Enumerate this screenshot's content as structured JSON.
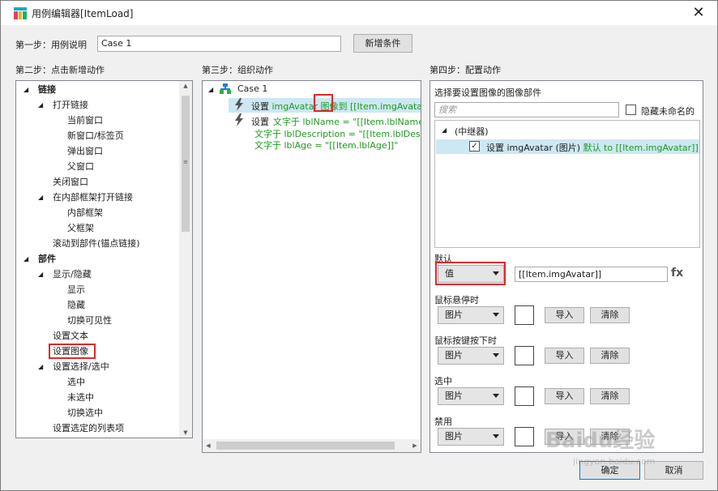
{
  "window": {
    "title": "用例编辑器[ItemLoad]",
    "close": "✕"
  },
  "step1": {
    "label": "第一步：用例说明",
    "case_value": "Case 1",
    "add_condition": "新增条件"
  },
  "step2": {
    "label": "第二步：点击新增动作",
    "items": [
      {
        "text": "链接",
        "bold": true,
        "expanded": true
      },
      {
        "text": "打开链接",
        "expanded": true
      },
      {
        "text": "当前窗口"
      },
      {
        "text": "新窗口/标签页"
      },
      {
        "text": "弹出窗口"
      },
      {
        "text": "父窗口"
      },
      {
        "text": "关闭窗口"
      },
      {
        "text": "在内部框架打开链接",
        "expanded": true
      },
      {
        "text": "内部框架"
      },
      {
        "text": "父框架"
      },
      {
        "text": "滚动到部件(锚点链接)"
      },
      {
        "text": "部件",
        "bold": true,
        "expanded": true
      },
      {
        "text": "显示/隐藏",
        "expanded": true
      },
      {
        "text": "显示"
      },
      {
        "text": "隐藏"
      },
      {
        "text": "切换可见性"
      },
      {
        "text": "设置文本"
      },
      {
        "text": "设置图像",
        "highlighted": true
      },
      {
        "text": "设置选择/选中",
        "expanded": true
      },
      {
        "text": "选中"
      },
      {
        "text": "未选中"
      },
      {
        "text": "切换选中"
      },
      {
        "text": "设置选定的列表项"
      }
    ]
  },
  "step3": {
    "label": "第三步：组织动作",
    "case_name": "Case 1",
    "action1": {
      "prefix": "设置",
      "target": "imgAvatar",
      "word": "图像",
      "to": "到",
      "value": "[[Item.imgAvatar]]"
    },
    "action2": {
      "prefix": "设置",
      "line1": "文字于 lblName = \"[[Item.lblName]]\", 与",
      "line2": "文字于 lblDescription = \"[[Item.lblDescriptio",
      "line3": "文字于 lblAge = \"[[Item.lblAge]]\""
    }
  },
  "step4": {
    "label": "第四步：配置动作",
    "select_label": "选择要设置图像的图像部件",
    "search_placeholder": "搜索",
    "hide_unnamed": "隐藏未命名的",
    "repeater": "(中继器)",
    "widget_row": {
      "prefix": "设置",
      "name": "imgAvatar",
      "type": "(图片)",
      "default": "默认 to [[Item.imgAvatar]]"
    },
    "default_label": "默认",
    "default_type": "值",
    "default_value": "[[Item.imgAvatar]]",
    "fx": "fx",
    "states": [
      {
        "label": "鼠标悬停时",
        "type": "图片",
        "import": "导入",
        "clear": "清除"
      },
      {
        "label": "鼠标按键按下时",
        "type": "图片",
        "import": "导入",
        "clear": "清除"
      },
      {
        "label": "选中",
        "type": "图片",
        "import": "导入",
        "clear": "清除"
      },
      {
        "label": "禁用",
        "type": "图片",
        "import": "导入",
        "clear": "清除"
      }
    ]
  },
  "footer": {
    "ok": "确定",
    "cancel": "取消"
  },
  "watermark": {
    "main": "Baidu经验",
    "sub": "jingyan.baidu.com"
  },
  "colors": {
    "selection": "#cce8f3",
    "highlight_red": "#e3262b",
    "action_green": "#1f9a1f",
    "link_blue": "#0078d7"
  }
}
